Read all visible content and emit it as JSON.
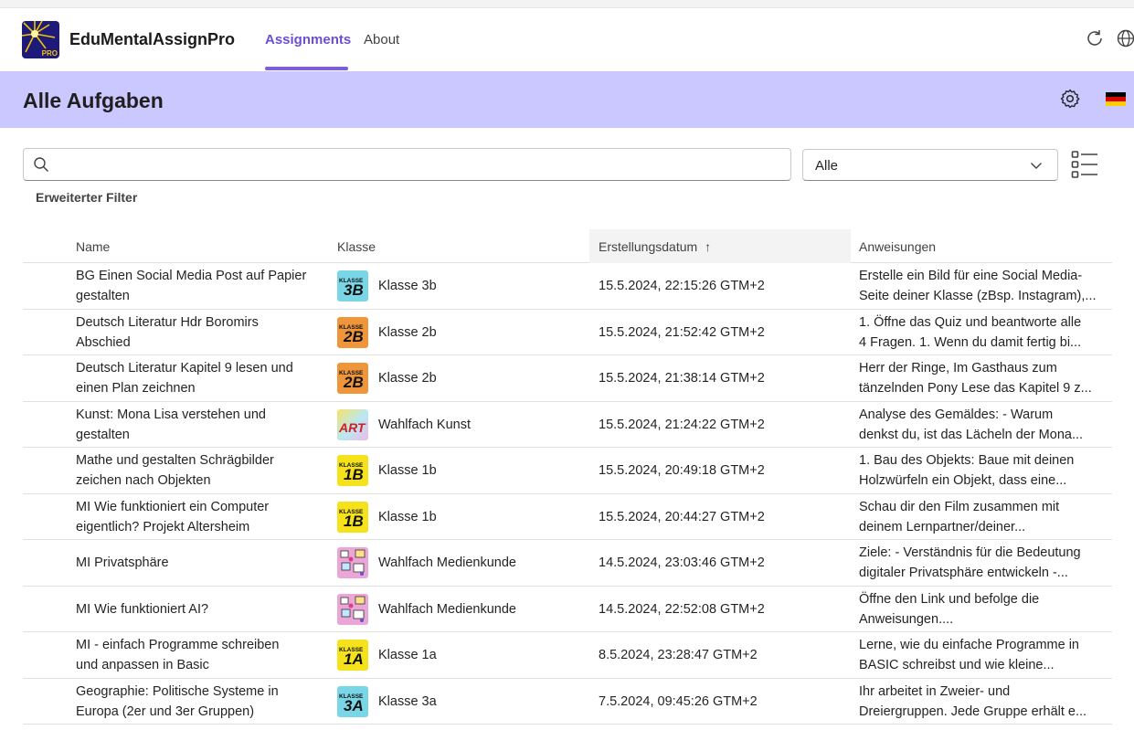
{
  "app": {
    "title": "EduMentalAssignPro",
    "logo_text": "PRO",
    "tabs": [
      {
        "label": "Assignments",
        "active": true
      },
      {
        "label": "About",
        "active": false
      }
    ],
    "accent_color": "#7b5ce6",
    "banner_color": "#cbc8ff"
  },
  "page": {
    "title": "Alle Aufgaben"
  },
  "filters": {
    "search_value": "",
    "search_placeholder": "",
    "select_value": "Alle",
    "advanced_filter_label": "Erweiterter Filter"
  },
  "table": {
    "columns": [
      "Name",
      "Klasse",
      "Erstellungsdatum",
      "Anweisungen"
    ],
    "sort_indicator": "↑",
    "rows": [
      {
        "name": [
          "BG Einen Social Media Post auf Papier",
          "gestalten"
        ],
        "badge": {
          "type": "klasse",
          "label": "KLASSE",
          "code": "3B",
          "color": "#79d6e6"
        },
        "class": "Klasse 3b",
        "date": "15.5.2024, 22:15:26 GTM+2",
        "instr": [
          "Erstelle ein Bild für eine Social Media-",
          "Seite deiner Klasse (zBsp. Instagram),..."
        ]
      },
      {
        "name": [
          "Deutsch Literatur Hdr Boromirs",
          "Abschied"
        ],
        "badge": {
          "type": "klasse",
          "label": "KLASSE",
          "code": "2B",
          "color": "#f0963a"
        },
        "class": "Klasse 2b",
        "date": "15.5.2024, 21:52:42 GTM+2",
        "instr": [
          "1. Öffne das Quiz und beantworte alle",
          "4 Fragen. 1. Wenn du damit fertig bi..."
        ]
      },
      {
        "name": [
          "Deutsch Literatur Kapitel 9 lesen und",
          "einen Plan zeichnen"
        ],
        "badge": {
          "type": "klasse",
          "label": "KLASSE",
          "code": "2B",
          "color": "#f0963a"
        },
        "class": "Klasse 2b",
        "date": "15.5.2024, 21:38:14 GTM+2",
        "instr": [
          "Herr der Ringe, Im Gasthaus zum",
          "tänzelnden Pony Lese das Kapitel 9 z..."
        ]
      },
      {
        "name": [
          "Kunst: Mona Lisa verstehen und",
          "gestalten"
        ],
        "badge": {
          "type": "art",
          "label": "ART",
          "code": "",
          "color": "#d9f0a3"
        },
        "class": "Wahlfach Kunst",
        "date": "15.5.2024, 21:24:22 GTM+2",
        "instr": [
          "Analyse des Gemäldes: - Warum",
          "denkst du, ist das Lächeln der Mona..."
        ]
      },
      {
        "name": [
          "Mathe und gestalten Schrägbilder",
          "zeichen nach Objekten"
        ],
        "badge": {
          "type": "klasse",
          "label": "KLASSE",
          "code": "1B",
          "color": "#f5e21a"
        },
        "class": "Klasse 1b",
        "date": "15.5.2024, 20:49:18 GTM+2",
        "instr": [
          "1. Bau des Objekts: Baue mit deinen",
          "Holzwürfeln ein Objekt, dass eine..."
        ]
      },
      {
        "name": [
          "MI Wie funktioniert ein Computer",
          "eigentlich? Projekt Altersheim"
        ],
        "badge": {
          "type": "klasse",
          "label": "KLASSE",
          "code": "1B",
          "color": "#f5e21a"
        },
        "class": "Klasse 1b",
        "date": "15.5.2024, 20:44:27 GTM+2",
        "instr": [
          "Schau dir den Film zusammen mit",
          "deinem Lernpartner/deiner..."
        ]
      },
      {
        "name": [
          "MI Privatsphäre"
        ],
        "badge": {
          "type": "medien",
          "label": "",
          "code": "",
          "color": "#e9a6d6"
        },
        "class": "Wahlfach Medienkunde",
        "date": "14.5.2024, 23:03:46 GTM+2",
        "instr": [
          "Ziele: - Verständnis für die Bedeutung",
          "digitaler Privatsphäre entwickeln -..."
        ]
      },
      {
        "name": [
          "MI Wie funktioniert AI?"
        ],
        "badge": {
          "type": "medien",
          "label": "",
          "code": "",
          "color": "#e9a6d6"
        },
        "class": "Wahlfach Medienkunde",
        "date": "14.5.2024, 22:52:08 GTM+2",
        "instr": [
          "Öffne den Link und befolge die",
          "Anweisungen...."
        ]
      },
      {
        "name": [
          "MI - einfach Programme schreiben",
          "und anpassen in Basic"
        ],
        "badge": {
          "type": "klasse",
          "label": "KLASSE",
          "code": "1A",
          "color": "#f5e21a"
        },
        "class": "Klasse 1a",
        "date": "8.5.2024, 23:28:47 GTM+2",
        "instr": [
          "Lerne, wie du einfache Programme in",
          "BASIC schreibst und wie kleine..."
        ]
      },
      {
        "name": [
          "Geographie: Politische Systeme in",
          "Europa (2er und 3er Gruppen)"
        ],
        "badge": {
          "type": "klasse",
          "label": "KLASSE",
          "code": "3A",
          "color": "#79d6e6"
        },
        "class": "Klasse 3a",
        "date": "7.5.2024, 09:45:26 GTM+2",
        "instr": [
          "Ihr arbeitet in Zweier- und",
          "Dreiergruppen. Jede Gruppe erhält e..."
        ]
      }
    ]
  }
}
